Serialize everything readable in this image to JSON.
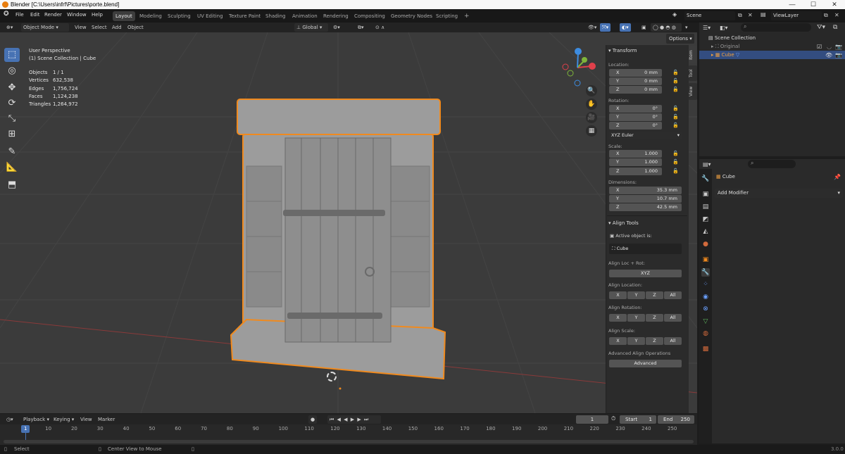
{
  "window": {
    "title": "Blender [C:\\Users\\infrf\\Pictures\\porte.blend]",
    "min": "—",
    "max": "☐",
    "close": "✕"
  },
  "menubar": {
    "items": [
      "File",
      "Edit",
      "Render",
      "Window",
      "Help"
    ]
  },
  "workspaces": [
    "Layout",
    "Modeling",
    "Sculpting",
    "UV Editing",
    "Texture Paint",
    "Shading",
    "Animation",
    "Rendering",
    "Compositing",
    "Geometry Nodes",
    "Scripting"
  ],
  "scene": {
    "name": "Scene",
    "viewlayer": "ViewLayer"
  },
  "viewport_header": {
    "mode": "Object Mode",
    "view": "View",
    "select": "Select",
    "add": "Add",
    "object": "Object",
    "orientation": "Global",
    "options": "Options"
  },
  "overlay_info": {
    "perspective": "User Perspective",
    "collection": "(1) Scene Collection | Cube"
  },
  "stats": [
    {
      "label": "Objects",
      "value": "1 / 1"
    },
    {
      "label": "Vertices",
      "value": "632,538"
    },
    {
      "label": "Edges",
      "value": "1,756,724"
    },
    {
      "label": "Faces",
      "value": "1,124,238"
    },
    {
      "label": "Triangles",
      "value": "1,264,972"
    }
  ],
  "npanel": {
    "tabs": [
      "Item",
      "Tool",
      "View"
    ],
    "transform_title": "Transform",
    "location_label": "Location:",
    "location": [
      {
        "axis": "X",
        "value": "0 mm"
      },
      {
        "axis": "Y",
        "value": "0 mm"
      },
      {
        "axis": "Z",
        "value": "0 mm"
      }
    ],
    "rotation_label": "Rotation:",
    "rotation": [
      {
        "axis": "X",
        "value": "0°"
      },
      {
        "axis": "Y",
        "value": "0°"
      },
      {
        "axis": "Z",
        "value": "0°"
      }
    ],
    "rotation_mode": "XYZ Euler",
    "scale_label": "Scale:",
    "scale": [
      {
        "axis": "X",
        "value": "1.000"
      },
      {
        "axis": "Y",
        "value": "1.000"
      },
      {
        "axis": "Z",
        "value": "1.000"
      }
    ],
    "dimensions_label": "Dimensions:",
    "dimensions": [
      {
        "axis": "X",
        "value": "35.3 mm"
      },
      {
        "axis": "Y",
        "value": "10.7 mm"
      },
      {
        "axis": "Z",
        "value": "42.5 mm"
      }
    ],
    "align_title": "Align Tools",
    "active_object_label": "Active object is:",
    "active_object": "Cube",
    "align_locrot_label": "Align Loc + Rot:",
    "xyz_btn": "XYZ",
    "align_location_label": "Align Location:",
    "align_rotation_label": "Align Rotation:",
    "align_scale_label": "Align Scale:",
    "axis_btns": [
      "X",
      "Y",
      "Z",
      "All"
    ],
    "advanced_label": "Advanced Align Operations",
    "advanced_btn": "Advanced"
  },
  "outliner": {
    "root": "Scene Collection",
    "items": [
      {
        "name": "Original"
      },
      {
        "name": "Cube"
      }
    ]
  },
  "properties": {
    "object_name": "Cube",
    "add_modifier": "Add Modifier"
  },
  "timeline": {
    "playback": "Playback",
    "keying": "Keying",
    "view": "View",
    "marker": "Marker",
    "current_frame": "1",
    "start_label": "Start",
    "start": "1",
    "end_label": "End",
    "end": "250",
    "ticks": [
      "1",
      "10",
      "20",
      "30",
      "40",
      "50",
      "60",
      "70",
      "80",
      "90",
      "100",
      "110",
      "120",
      "130",
      "140",
      "150",
      "160",
      "170",
      "180",
      "190",
      "200",
      "210",
      "220",
      "230",
      "240",
      "250"
    ]
  },
  "statusbar": {
    "select": "Select",
    "center": "Center View to Mouse",
    "version": "3.0.0"
  },
  "colors": {
    "selection": "#f08a1e",
    "accent": "#4772b3",
    "gizmo_x": "#e0404b",
    "gizmo_y": "#7fb53a",
    "gizmo_z": "#3d8ce0"
  }
}
